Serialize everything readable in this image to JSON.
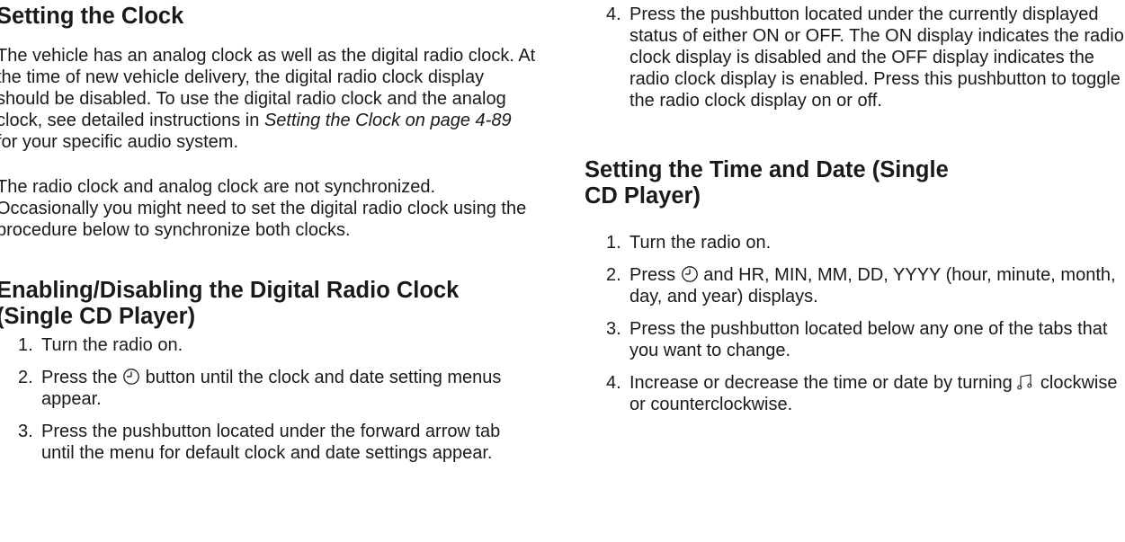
{
  "left": {
    "title": "Setting the Clock",
    "para1": {
      "before": "The vehicle has an analog clock as well as the digital radio clock. At the time of new vehicle delivery, the digital radio clock display should be disabled. To use the digital radio clock and the analog clock, see detailed instructions in ",
      "ref": "Setting the Clock on page 4-89",
      "after": " for your specific audio system."
    },
    "para2": "The radio clock and analog clock are not synchronized. Occasionally you might need to set the digital radio clock using the procedure below to synchronize both clocks.",
    "heading2": "Enabling/Disabling the Digital Radio Clock (Single CD Player)",
    "steps": [
      {
        "num": "1.",
        "text": "Turn the radio on."
      },
      {
        "num": "2.",
        "before": "Press the ",
        "after": " button until the clock and date setting menus appear."
      },
      {
        "num": "3.",
        "text": "Press the pushbutton located under the forward arrow tab until the menu for default clock and date settings appear."
      }
    ]
  },
  "right": {
    "step4": {
      "num": "4.",
      "text": "Press the pushbutton located under the currently displayed status of either ON or OFF. The ON display indicates the radio clock display is disabled and the OFF display indicates the radio clock display is enabled. Press this pushbutton to toggle the radio clock display on or off."
    },
    "heading": "Setting the Time and Date (Single CD Player)",
    "steps": [
      {
        "num": "1.",
        "text": "Turn the radio on."
      },
      {
        "num": "2.",
        "before": "Press ",
        "after": " and HR, MIN, MM, DD, YYYY (hour, minute, month, day, and year) displays."
      },
      {
        "num": "3.",
        "text": "Press the pushbutton located below any one of the tabs that you want to change."
      },
      {
        "num": "4.",
        "before": "Increase or decrease the time or date by turning ",
        "after": " clockwise or counterclockwise."
      }
    ]
  },
  "icons": {
    "clock": "clock-icon",
    "tune": "tune-knob-icon"
  }
}
